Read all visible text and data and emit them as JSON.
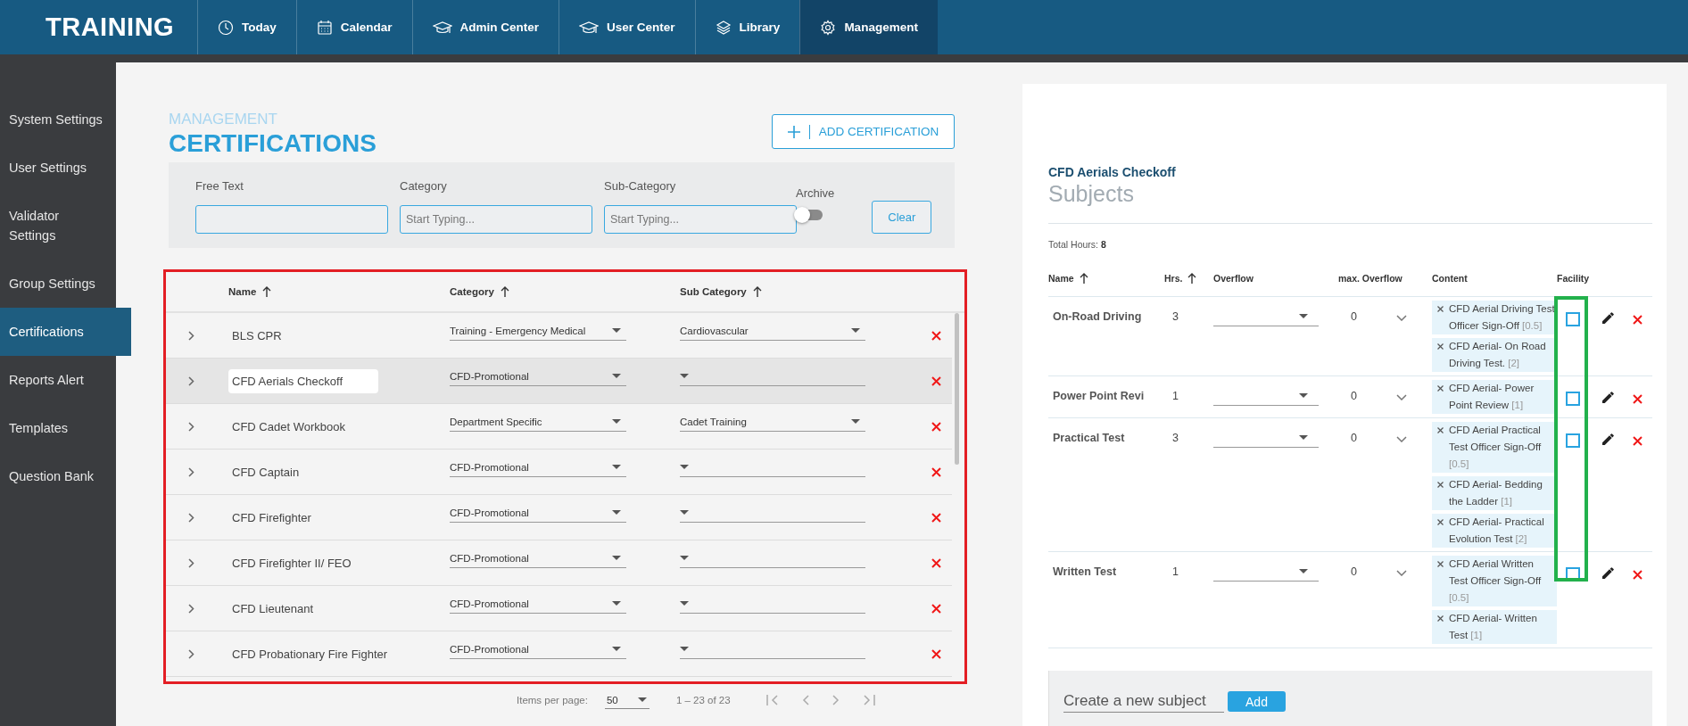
{
  "app": {
    "title": "TRAINING"
  },
  "nav": [
    {
      "label": "Today",
      "selected": false
    },
    {
      "label": "Calendar",
      "selected": false
    },
    {
      "label": "Admin Center",
      "selected": false
    },
    {
      "label": "User Center",
      "selected": false
    },
    {
      "label": "Library",
      "selected": false
    },
    {
      "label": "Management",
      "selected": true
    }
  ],
  "sidebar": {
    "items": [
      {
        "label": "System Settings",
        "selected": false
      },
      {
        "label": "User Settings",
        "selected": false
      },
      {
        "label": "Validator Settings",
        "selected": false
      },
      {
        "label": "Group Settings",
        "selected": false
      },
      {
        "label": "Certifications",
        "selected": true
      },
      {
        "label": "Reports Alert",
        "selected": false
      },
      {
        "label": "Templates",
        "selected": false
      },
      {
        "label": "Question Bank",
        "selected": false
      }
    ]
  },
  "page": {
    "breadcrumb": "MANAGEMENT",
    "title": "CERTIFICATIONS",
    "add_button": "ADD CERTIFICATION"
  },
  "filters": {
    "free_text": {
      "label": "Free Text"
    },
    "category": {
      "label": "Category",
      "placeholder": "Start Typing..."
    },
    "sub_category": {
      "label": "Sub-Category",
      "placeholder": "Start Typing..."
    },
    "archive": {
      "label": "Archive",
      "on": false
    },
    "clear_button": "Clear"
  },
  "certifications": {
    "highlight": {
      "color": "#e31e24"
    },
    "columns": [
      "Name",
      "Category",
      "Sub Category"
    ],
    "rows": [
      {
        "name": "BLS CPR",
        "category": "Training - Emergency Medical",
        "sub_category": "Cardiovascular",
        "selected": false
      },
      {
        "name": "CFD Aerials Checkoff",
        "category": "CFD-Promotional",
        "selected": true
      },
      {
        "name": "CFD Cadet Workbook",
        "category": "Department Specific",
        "sub_category": "Cadet Training",
        "selected": false
      },
      {
        "name": "CFD Captain",
        "category": "CFD-Promotional",
        "selected": false
      },
      {
        "name": "CFD Firefighter",
        "category": "CFD-Promotional",
        "selected": false
      },
      {
        "name": "CFD Firefighter II/ FEO",
        "category": "CFD-Promotional",
        "selected": false
      },
      {
        "name": "CFD Lieutenant",
        "category": "CFD-Promotional",
        "selected": false
      },
      {
        "name": "CFD Probationary Fire Fighter",
        "category": "CFD-Promotional",
        "selected": false
      }
    ]
  },
  "pagination": {
    "items_per_page_label": "Items per page:",
    "items_per_page": "50",
    "range": "1 – 23 of 23"
  },
  "subjects_panel": {
    "certification": "CFD Aerials Checkoff",
    "title": "Subjects",
    "total_hours_label": "Total Hours:",
    "total_hours": "8",
    "facility_highlight": {
      "color": "#22b14c"
    },
    "columns": [
      "Name",
      "Hrs.",
      "Overflow",
      "max. Overflow",
      "Content",
      "Facility"
    ],
    "rows": [
      {
        "name": "On-Road Driving",
        "hours": "3",
        "max_overflow": "0",
        "facility": false,
        "content": [
          {
            "label": "CFD Aerial Driving Test Officer Sign-Off",
            "hours": "[0.5]"
          },
          {
            "label": "CFD Aerial- On Road Driving Test.",
            "hours": "[2]"
          }
        ]
      },
      {
        "name": "Power Point Revi",
        "hours": "1",
        "max_overflow": "0",
        "facility": false,
        "content": [
          {
            "label": "CFD Aerial- Power Point Review",
            "hours": "[1]"
          }
        ]
      },
      {
        "name": "Practical Test",
        "hours": "3",
        "max_overflow": "0",
        "facility": false,
        "content": [
          {
            "label": "CFD Aerial Practical Test Officer Sign-Off",
            "hours": "[0.5]"
          },
          {
            "label": "CFD Aerial- Bedding the Ladder",
            "hours": "[1]"
          },
          {
            "label": "CFD Aerial- Practical Evolution Test",
            "hours": "[2]"
          }
        ]
      },
      {
        "name": "Written Test",
        "hours": "1",
        "max_overflow": "0",
        "facility": false,
        "content": [
          {
            "label": "CFD Aerial Written Test Officer Sign-Off",
            "hours": "[0.5]"
          },
          {
            "label": "CFD Aerial- Written Test",
            "hours": "[1]"
          }
        ]
      }
    ]
  },
  "new_subject": {
    "placeholder": "Create a new subject",
    "button": "Add"
  }
}
